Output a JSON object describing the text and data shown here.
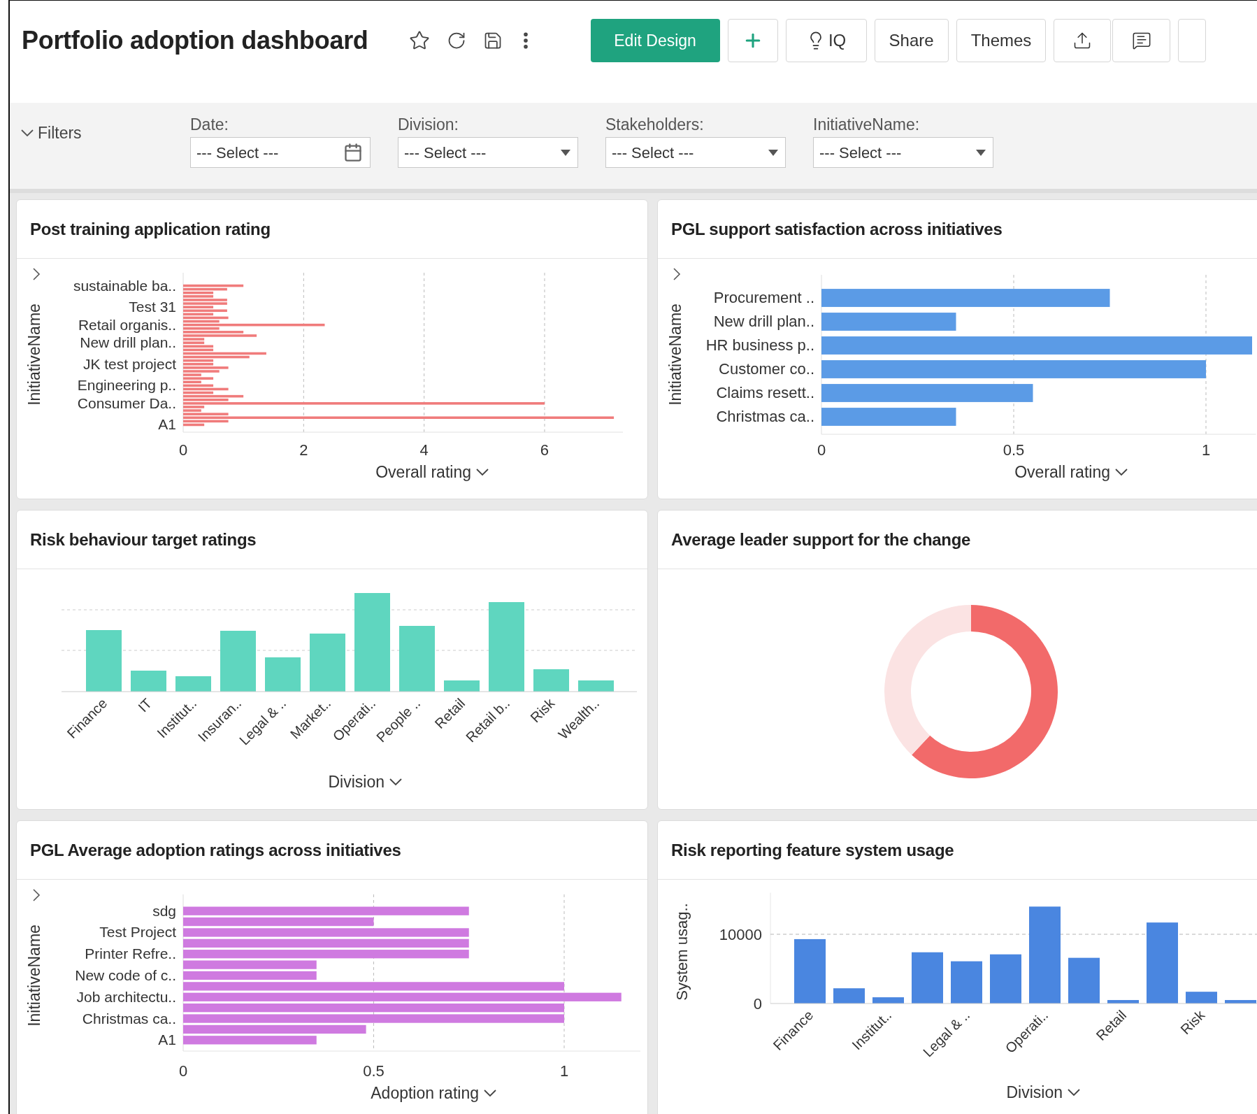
{
  "header": {
    "title": "Portfolio adoption dashboard",
    "buttons": [
      {
        "kind": "primary",
        "label": "Edit Design"
      },
      {
        "kind": "add"
      },
      {
        "kind": "iq",
        "label": "IQ"
      },
      {
        "kind": "plain",
        "label": "Share"
      },
      {
        "kind": "plain",
        "label": "Themes"
      },
      {
        "kind": "export"
      },
      {
        "kind": "comment"
      },
      {
        "kind": "cut"
      }
    ]
  },
  "filters": {
    "label": "Filters",
    "expanded": true,
    "fields": [
      {
        "kind": "date",
        "label": "Date:",
        "value": "--- Select ---"
      },
      {
        "kind": "select",
        "label": "Division:",
        "value": "--- Select ---"
      },
      {
        "kind": "select",
        "label": "Stakeholders:",
        "value": "--- Select ---"
      },
      {
        "kind": "select",
        "label": "InitiativeName:",
        "value": "--- Select ---"
      }
    ]
  },
  "panels": [
    {
      "title": "Post training application rating",
      "chart_data": {
        "type": "bar",
        "orientation": "horizontal",
        "grid": true,
        "xlabel": "Overall rating",
        "ylabel": "InitiativeName",
        "xlim": [
          0,
          7.3
        ],
        "xticks": [
          0,
          2,
          4,
          6
        ],
        "categories": [
          "sustainable ba..",
          null,
          null,
          null,
          null,
          null,
          "Test 31",
          null,
          null,
          null,
          null,
          "Retail organis..",
          null,
          null,
          null,
          null,
          "New drill plan..",
          null,
          null,
          null,
          null,
          null,
          "JK test project",
          null,
          null,
          null,
          null,
          null,
          "Engineering p..",
          null,
          null,
          null,
          null,
          "Consumer Da..",
          null,
          null,
          null,
          null,
          null,
          "A1"
        ],
        "series": [
          {
            "color": "#f07b7b",
            "values": [
              1.0,
              0.73,
              0.5,
              0.5,
              0.73,
              0.73,
              0.5,
              0.73,
              0.5,
              0.75,
              0.6,
              2.35,
              0.6,
              1.0,
              1.22,
              0.35,
              0.35,
              0.5,
              0.5,
              1.38,
              1.1,
              0.5,
              0.5,
              0.75,
              0.6,
              0.3,
              0.5,
              0.3,
              0.5,
              0.75,
              0.5,
              1.0,
              0.75,
              6.0,
              0.35,
              0.3,
              0.75,
              7.15,
              0.75,
              0.35
            ]
          }
        ]
      }
    },
    {
      "title": "PGL support satisfaction across initiatives",
      "chart_data": {
        "type": "bar",
        "orientation": "horizontal",
        "grid": true,
        "xlabel": "Overall rating",
        "ylabel": "InitiativeName",
        "xlim": [
          0,
          1.13
        ],
        "xticks": [
          0,
          0.5,
          1
        ],
        "categories": [
          "Procurement ..",
          "New drill plan..",
          "HR business p..",
          "Customer co..",
          "Claims resett..",
          "Christmas ca.."
        ],
        "series": [
          {
            "color": "#5b9be6",
            "values": [
              0.75,
              0.35,
              1.12,
              1.0,
              0.55,
              0.35
            ]
          }
        ]
      }
    },
    {
      "kind": "column_picture",
      "title": "Risk behaviour target ratings",
      "xlabel": "Division",
      "categories": [
        "Finance",
        "IT",
        "Institut..",
        "Insuran..",
        "Legal & ..",
        "Market..",
        "Operati..",
        "People ..",
        "Retail",
        "Retail b..",
        "Risk",
        "Wealth.."
      ]
    },
    {
      "kind": "donut",
      "title": "Average leader support for the change"
    },
    {
      "title": "PGL Average adoption ratings across initiatives",
      "chart_data": {
        "type": "bar",
        "orientation": "horizontal",
        "grid": true,
        "xlabel": "Adoption rating",
        "ylabel": "InitiativeName",
        "xlim": [
          0,
          1.2
        ],
        "xticks": [
          0,
          0.5,
          1
        ],
        "categories": [
          "sdg",
          null,
          "Test Project",
          null,
          "Printer Refre..",
          null,
          "New code of c..",
          null,
          "Job architectu..",
          null,
          "Christmas ca..",
          null,
          "A1"
        ],
        "series": [
          {
            "color": "#cf7ae0",
            "values": [
              0.75,
              0.5,
              0.75,
              0.75,
              0.75,
              0.35,
              0.35,
              1.0,
              1.15,
              1.0,
              1.0,
              0.48,
              0.35
            ]
          }
        ]
      }
    },
    {
      "title": "Risk reporting feature system usage",
      "chart_data": {
        "type": "bar",
        "orientation": "vertical",
        "grid": true,
        "xlabel": "Division",
        "ylabel": "System usag..",
        "ylim": [
          0,
          16000
        ],
        "yticks": [
          0,
          10000
        ],
        "categories": [
          "Finance",
          null,
          "Institut..",
          null,
          "Legal & ..",
          null,
          "Operati..",
          null,
          "Retail",
          null,
          "Risk",
          null
        ],
        "series": [
          {
            "color": "#4a86e0",
            "values": [
              9300,
              2200,
              900,
              7400,
              6100,
              7100,
              14000,
              6600,
              500,
              11700,
              1700,
              500
            ]
          }
        ]
      }
    }
  ]
}
